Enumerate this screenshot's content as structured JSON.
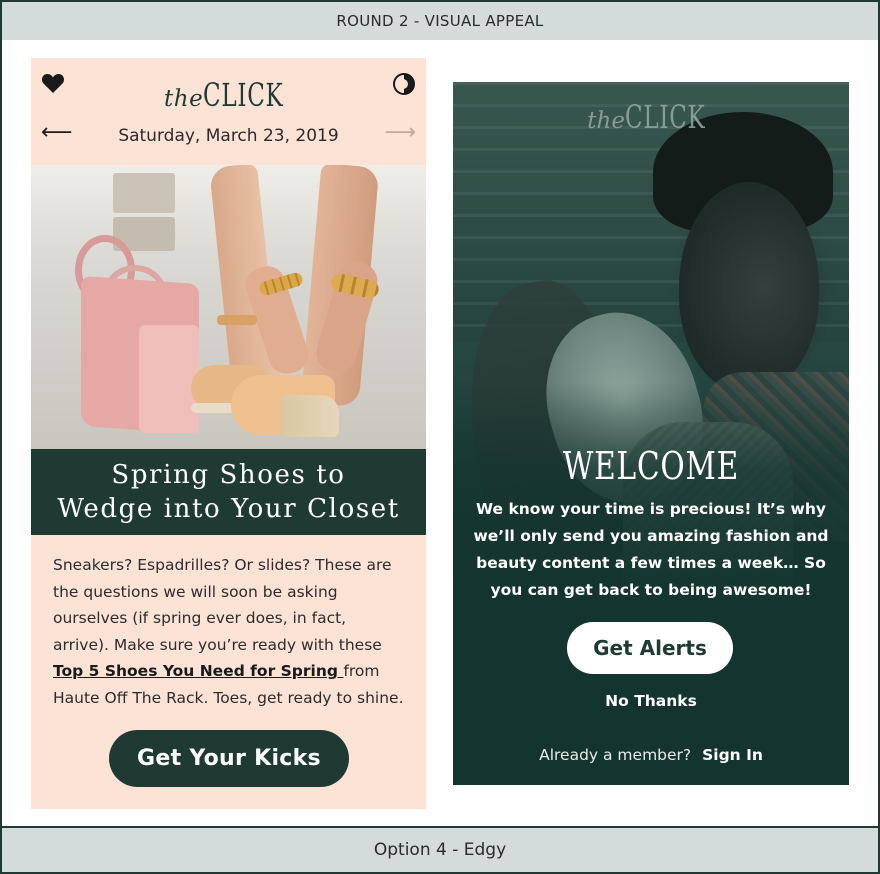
{
  "header": {
    "title": "ROUND 2 - VISUAL APPEAL"
  },
  "footer": {
    "caption": "Option 4 - Edgy"
  },
  "left_screen": {
    "logo_the": "the",
    "logo_click": "CLICK",
    "date": "Saturday, March 23, 2019",
    "icons": {
      "favorite": "heart-icon",
      "theme": "contrast-icon",
      "prev": "arrow-left-icon",
      "next": "arrow-right-icon"
    },
    "headline_line1": "Spring Shoes to",
    "headline_line2": "Wedge into Your Closet",
    "body_before_link": "Sneakers? Espadrilles? Or slides? These are the questions we will soon be asking ourselves (if spring ever does, in fact, arrive). Make sure you’re ready with these ",
    "body_link": "Top 5 Shoes You Need for Spring ",
    "body_after_link": "from Haute Off The Rack. Toes, get ready to shine.",
    "cta_label": "Get Your Kicks",
    "colors": {
      "background": "#fde2d6",
      "accent": "#1f3a33"
    }
  },
  "right_screen": {
    "logo_the": "the",
    "logo_click": "CLICK",
    "welcome": "WELCOME",
    "message": "We know your time is precious! It’s why we’ll only send you amazing fashion and beauty content a few times a week… So you can get back to being awesome!",
    "alerts_button": "Get Alerts",
    "decline_link": "No Thanks",
    "member_prompt": "Already a member?",
    "sign_in": "Sign In",
    "colors": {
      "overlay": "#14352e"
    }
  }
}
